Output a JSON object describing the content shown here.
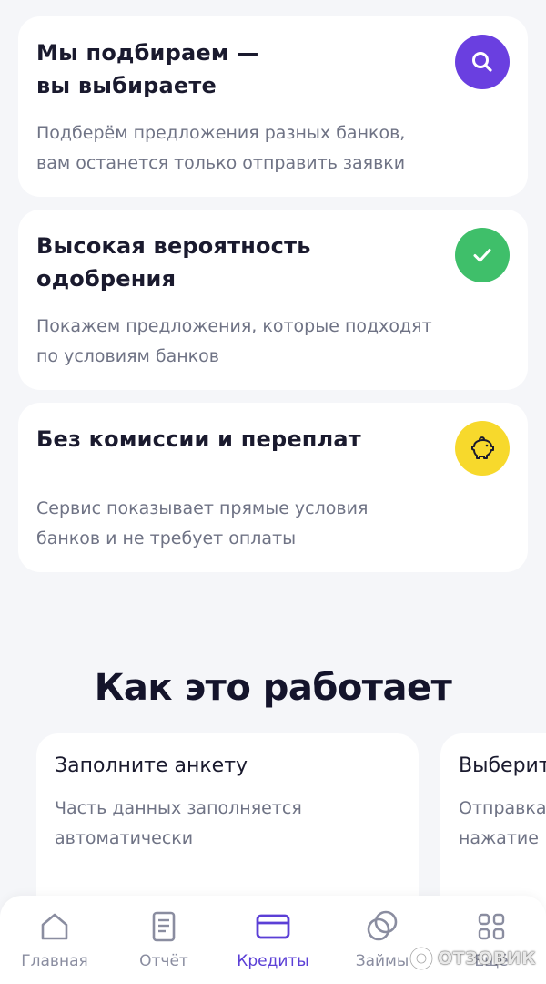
{
  "features": [
    {
      "title": "Мы подбираем —\nвы выбираете",
      "text": "Подберём предложения разных банков,\nвам останется только отправить заявки",
      "icon": "search-icon",
      "color": "#6a3fe0"
    },
    {
      "title": "Высокая вероятность\nодобрения",
      "text": "Покажем предложения, которые подходят\nпо условиям банков",
      "icon": "check-icon",
      "color": "#3fbf6a"
    },
    {
      "title": "Без комиссии и переплат",
      "text": "Сервис показывает прямые условия\nбанков и не требует оплаты",
      "icon": "piggy-bank-icon",
      "color": "#f7d92c"
    }
  ],
  "how_it_works": {
    "title": "Как это работает",
    "steps": [
      {
        "title": "Заполните анкету",
        "text": "Часть данных заполняется\nавтоматически"
      },
      {
        "title": "Выберит",
        "text": "Отправка\nнажатие"
      }
    ]
  },
  "tabbar": {
    "items": [
      {
        "label": "Главная",
        "icon": "home-icon",
        "active": false
      },
      {
        "label": "Отчёт",
        "icon": "report-icon",
        "active": false
      },
      {
        "label": "Кредиты",
        "icon": "credit-card-icon",
        "active": true
      },
      {
        "label": "Займы",
        "icon": "loans-icon",
        "active": false
      },
      {
        "label": "Ещё",
        "icon": "more-grid-icon",
        "active": false
      }
    ],
    "active_color": "#5b3fd6",
    "inactive_color": "#8a8da0"
  },
  "watermark": "ОТЗОВИК"
}
